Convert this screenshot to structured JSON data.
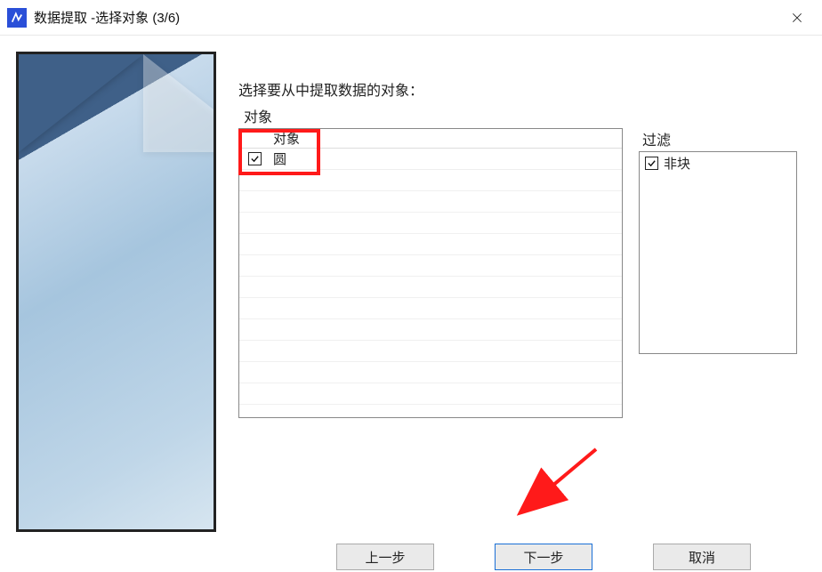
{
  "window": {
    "title": "数据提取 -选择对象 (3/6)"
  },
  "instruction": "选择要从中提取数据的对象：",
  "objects": {
    "group_label": "对象",
    "header": "对象",
    "items": [
      {
        "checked": true,
        "name": "圆"
      }
    ]
  },
  "filter": {
    "group_label": "过滤",
    "items": [
      {
        "checked": true,
        "name": "非块"
      }
    ]
  },
  "buttons": {
    "back": "上一步",
    "next": "下一步",
    "cancel": "取消"
  },
  "annotations": {
    "highlight_color": "#ff1a1a"
  }
}
